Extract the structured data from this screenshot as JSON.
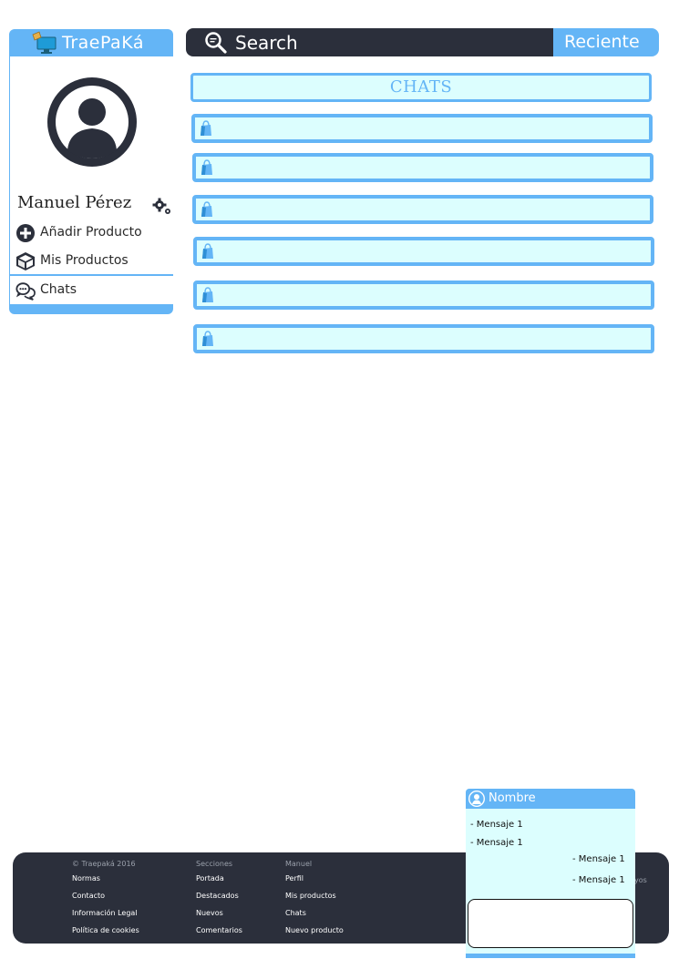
{
  "brand": {
    "title": "TraePaKá"
  },
  "user": {
    "name": "Manuel Pérez"
  },
  "menu": [
    {
      "label": "Añadir Producto",
      "icon": "plus-circle-icon"
    },
    {
      "label": "Mis Productos",
      "icon": "box-icon"
    },
    {
      "label": "Chats",
      "icon": "chat-bubbles-icon"
    }
  ],
  "search": {
    "placeholder": "Search",
    "recent_label": "Reciente"
  },
  "chats": {
    "header": "CHATS",
    "rows": [
      "",
      "",
      "",
      "",
      "",
      ""
    ]
  },
  "footer": {
    "col1": [
      "© Traepaká 2016",
      "Normas",
      "Contacto",
      "Información Legal",
      "Política de cookies"
    ],
    "col2": [
      "Secciones",
      "Portada",
      "Destacados",
      "Nuevos",
      "Comentarios"
    ],
    "col3": [
      "Manuel",
      "Perfil",
      "Mis productos",
      "Chats",
      "Nuevo producto"
    ],
    "cut_text": "yos"
  },
  "popup": {
    "title": "Nombre",
    "messages": [
      {
        "text": "- Mensaje 1",
        "side": "left"
      },
      {
        "text": "- Mensaje 1",
        "side": "left"
      },
      {
        "text": "- Mensaje 1",
        "side": "right"
      },
      {
        "text": "- Mensaje 1",
        "side": "right"
      }
    ],
    "input_value": ""
  },
  "colors": {
    "accent": "#64b5f6",
    "dark": "#2b2f3b",
    "light_cyan": "#dcfefe"
  }
}
